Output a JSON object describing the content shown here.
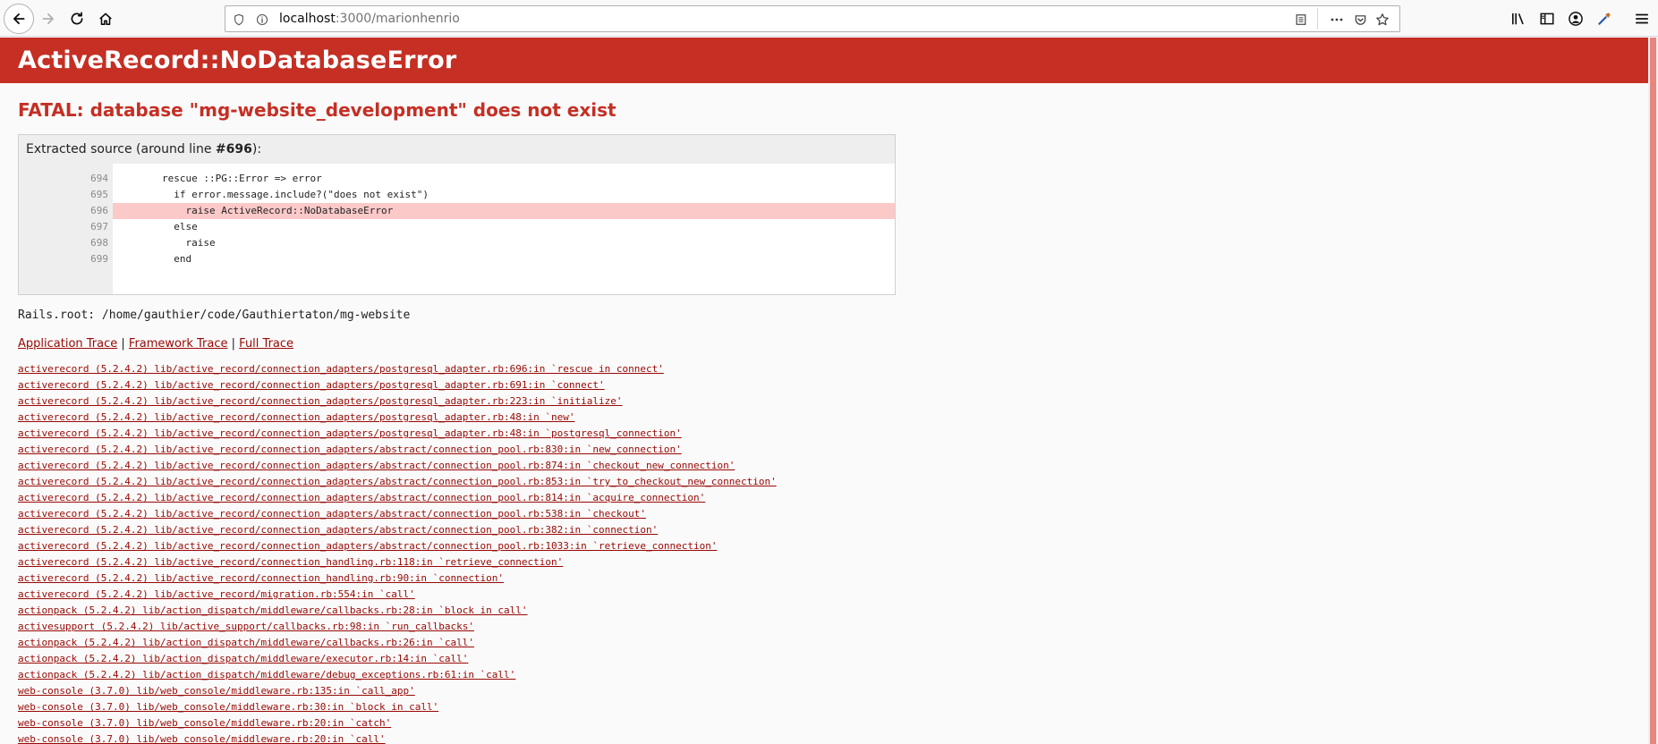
{
  "browser": {
    "url_host": "localhost",
    "url_path": ":3000/marionhenrio",
    "icons": [
      "back-arrow-icon",
      "forward-arrow-icon",
      "reload-icon",
      "home-icon",
      "shield-icon",
      "info-icon",
      "reader-view-icon",
      "more-actions-icon",
      "pocket-icon",
      "star-icon",
      "library-icon",
      "sidebar-icon",
      "account-icon",
      "eyedropper-icon",
      "hamburger-menu-icon"
    ]
  },
  "error": {
    "title": "ActiveRecord::NoDatabaseError",
    "message": "FATAL: database \"mg-website_development\" does not exist",
    "source_label_prefix": "Extracted source (around line ",
    "source_line_ref": "#696",
    "source_label_suffix": "):",
    "source_lines": [
      {
        "num": "694",
        "code": "        rescue ::PG::Error => error",
        "highlight": false
      },
      {
        "num": "695",
        "code": "          if error.message.include?(\"does not exist\")",
        "highlight": false
      },
      {
        "num": "696",
        "code": "            raise ActiveRecord::NoDatabaseError",
        "highlight": true
      },
      {
        "num": "697",
        "code": "          else",
        "highlight": false
      },
      {
        "num": "698",
        "code": "            raise",
        "highlight": false
      },
      {
        "num": "699",
        "code": "          end",
        "highlight": false
      }
    ],
    "rails_root": "Rails.root: /home/gauthier/code/Gauthiertaton/mg-website"
  },
  "trace": {
    "links": [
      "Application Trace",
      "Framework Trace",
      "Full Trace"
    ],
    "separator": " | ",
    "frames": [
      "activerecord (5.2.4.2) lib/active_record/connection_adapters/postgresql_adapter.rb:696:in `rescue in connect'",
      "activerecord (5.2.4.2) lib/active_record/connection_adapters/postgresql_adapter.rb:691:in `connect'",
      "activerecord (5.2.4.2) lib/active_record/connection_adapters/postgresql_adapter.rb:223:in `initialize'",
      "activerecord (5.2.4.2) lib/active_record/connection_adapters/postgresql_adapter.rb:48:in `new'",
      "activerecord (5.2.4.2) lib/active_record/connection_adapters/postgresql_adapter.rb:48:in `postgresql_connection'",
      "activerecord (5.2.4.2) lib/active_record/connection_adapters/abstract/connection_pool.rb:830:in `new_connection'",
      "activerecord (5.2.4.2) lib/active_record/connection_adapters/abstract/connection_pool.rb:874:in `checkout_new_connection'",
      "activerecord (5.2.4.2) lib/active_record/connection_adapters/abstract/connection_pool.rb:853:in `try_to_checkout_new_connection'",
      "activerecord (5.2.4.2) lib/active_record/connection_adapters/abstract/connection_pool.rb:814:in `acquire_connection'",
      "activerecord (5.2.4.2) lib/active_record/connection_adapters/abstract/connection_pool.rb:538:in `checkout'",
      "activerecord (5.2.4.2) lib/active_record/connection_adapters/abstract/connection_pool.rb:382:in `connection'",
      "activerecord (5.2.4.2) lib/active_record/connection_adapters/abstract/connection_pool.rb:1033:in `retrieve_connection'",
      "activerecord (5.2.4.2) lib/active_record/connection_handling.rb:118:in `retrieve_connection'",
      "activerecord (5.2.4.2) lib/active_record/connection_handling.rb:90:in `connection'",
      "activerecord (5.2.4.2) lib/active_record/migration.rb:554:in `call'",
      "actionpack (5.2.4.2) lib/action_dispatch/middleware/callbacks.rb:28:in `block in call'",
      "activesupport (5.2.4.2) lib/active_support/callbacks.rb:98:in `run_callbacks'",
      "actionpack (5.2.4.2) lib/action_dispatch/middleware/callbacks.rb:26:in `call'",
      "actionpack (5.2.4.2) lib/action_dispatch/middleware/executor.rb:14:in `call'",
      "actionpack (5.2.4.2) lib/action_dispatch/middleware/debug_exceptions.rb:61:in `call'",
      "web-console (3.7.0) lib/web_console/middleware.rb:135:in `call_app'",
      "web-console (3.7.0) lib/web_console/middleware.rb:30:in `block in call'",
      "web-console (3.7.0) lib/web_console/middleware.rb:20:in `catch'",
      "web-console (3.7.0) lib/web_console/middleware.rb:20:in `call'"
    ]
  },
  "colors": {
    "header_red": "#c52f24",
    "link_red": "#980905",
    "highlight": "#fcc9c9"
  }
}
